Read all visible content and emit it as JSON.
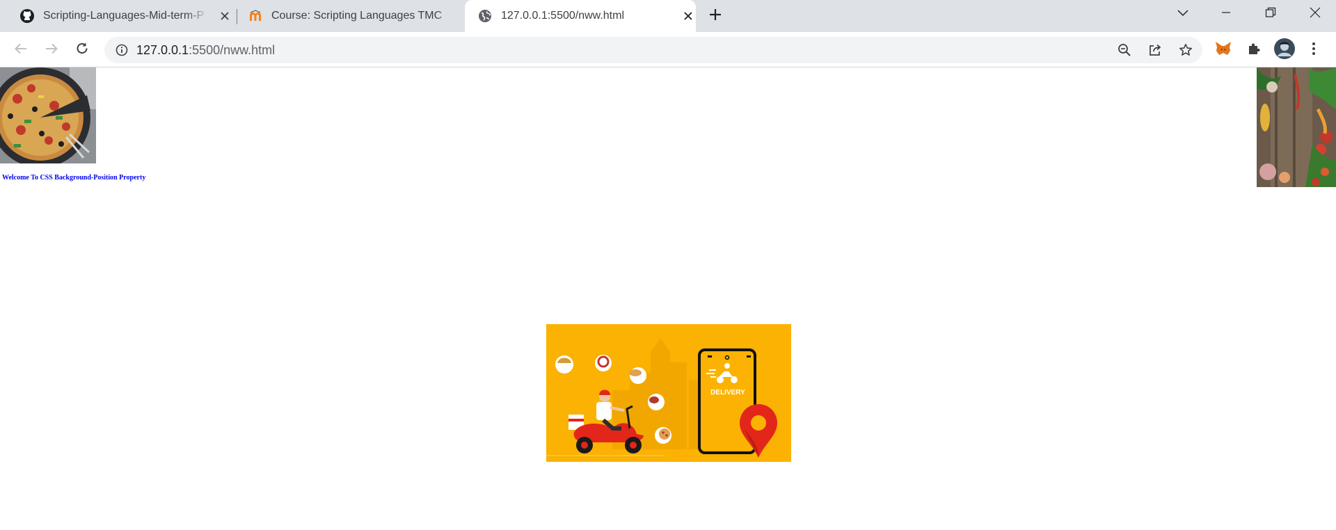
{
  "browser": {
    "tabs": [
      {
        "title": "Scripting-Languages-Mid-term-P",
        "icon": "github-icon",
        "active": false
      },
      {
        "title": "Course: Scripting Languages TMC",
        "icon": "moodle-icon",
        "active": false
      },
      {
        "title": "127.0.0.1:5500/nww.html",
        "icon": "globe-icon",
        "active": true
      }
    ],
    "url_host": "127.0.0.1",
    "url_rest": ":5500/nww.html"
  },
  "page": {
    "welcome_text": "Welcome To CSS Background-Position Property",
    "delivery_label": "DELIVERY",
    "images": [
      "pizza-image",
      "vegetables-image",
      "food-delivery-illustration"
    ]
  },
  "colors": {
    "tabstrip": "#dee1e6",
    "link_blue": "#0000ee",
    "delivery_yellow": "#fbb202",
    "scooter_red": "#e3261a"
  }
}
